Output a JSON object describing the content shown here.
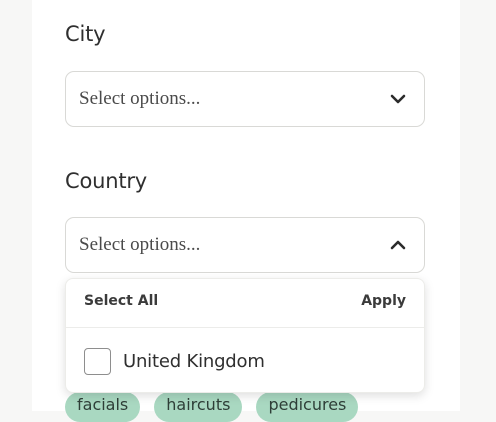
{
  "city": {
    "label": "City",
    "placeholder": "Select options...",
    "chevron": "chevron-down-icon"
  },
  "country": {
    "label": "Country",
    "placeholder": "Select options...",
    "chevron": "chevron-up-icon",
    "dropdown": {
      "select_all": "Select All",
      "apply": "Apply",
      "options": [
        {
          "label": "United Kingdom",
          "checked": false
        }
      ]
    }
  },
  "tags": [
    "facials",
    "haircuts",
    "pedicures"
  ],
  "colors": {
    "tag_background": "#a9d8c1",
    "page_background": "#f7f7f6"
  }
}
